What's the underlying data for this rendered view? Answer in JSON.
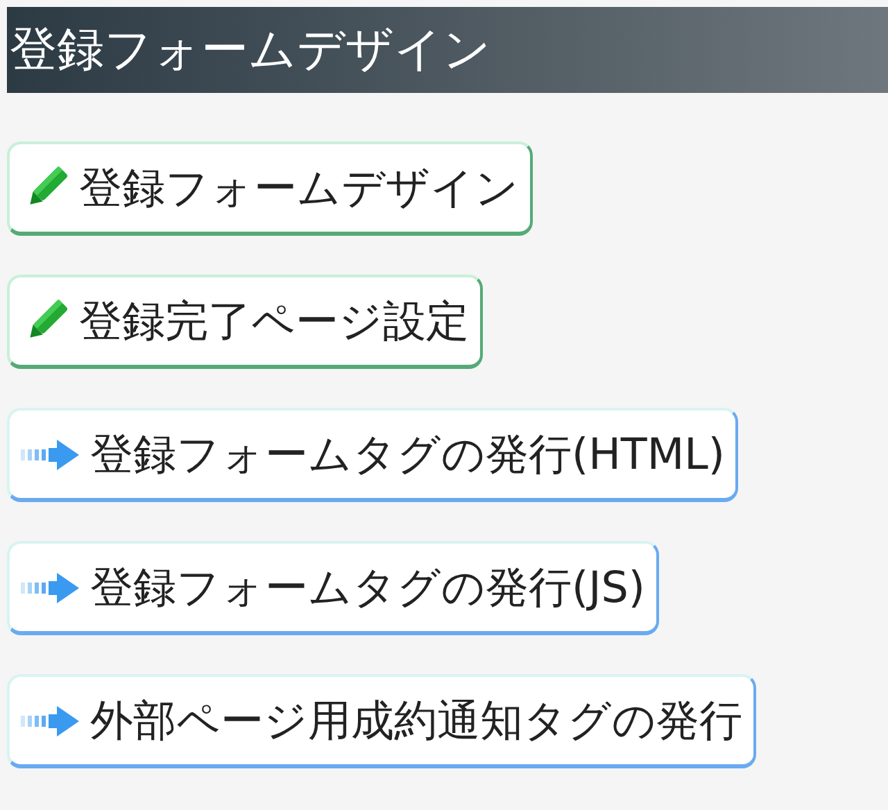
{
  "header": {
    "title": "登録フォームデザイン"
  },
  "buttons": [
    {
      "kind": "edit",
      "label": "登録フォームデザイン"
    },
    {
      "kind": "edit",
      "label": "登録完了ページ設定"
    },
    {
      "kind": "link",
      "label": "登録フォームタグの発行(HTML)"
    },
    {
      "kind": "link",
      "label": "登録フォームタグの発行(JS)"
    },
    {
      "kind": "link",
      "label": "外部ページ用成約通知タグの発行"
    }
  ]
}
